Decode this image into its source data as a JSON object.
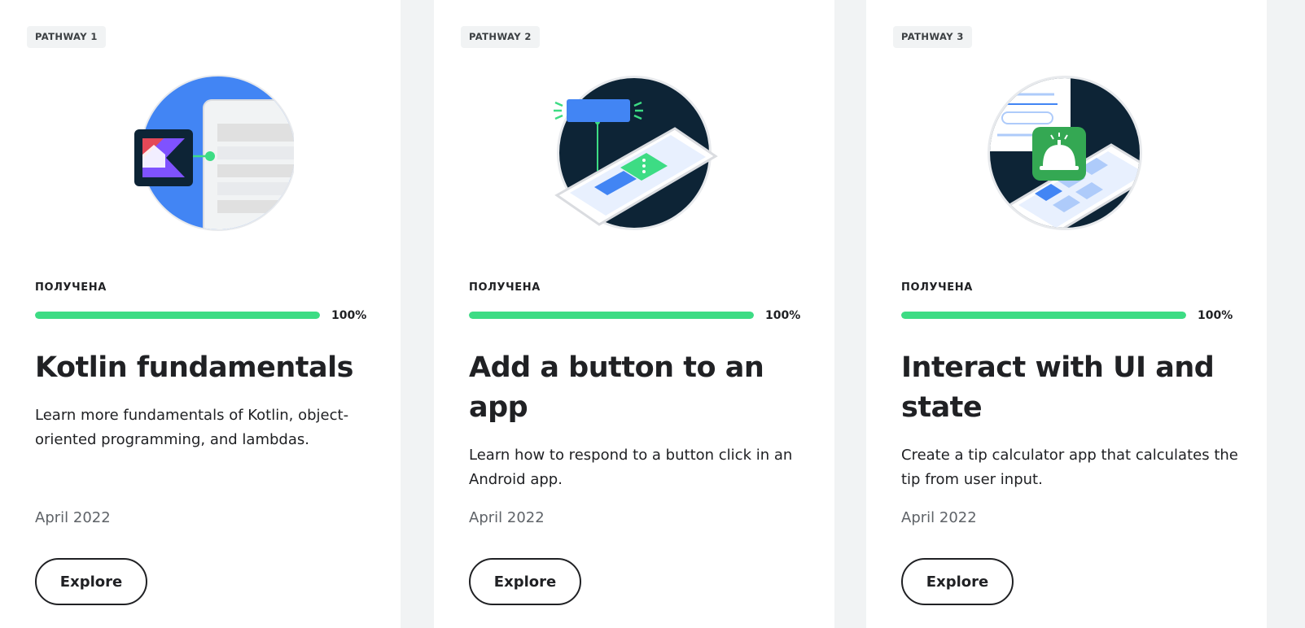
{
  "cards": [
    {
      "pathway": "PATHWAY 1",
      "status": "ПОЛУЧЕНА",
      "progress_percent": 100,
      "progress_label": "100%",
      "title": "Kotlin fundamentals",
      "description": "Learn more fundamentals of Kotlin, object-oriented programming, and lambdas.",
      "date": "April 2022",
      "button_label": "Explore",
      "illustration_icon": "kotlin-logo-icon"
    },
    {
      "pathway": "PATHWAY 2",
      "status": "ПОЛУЧЕНА",
      "progress_percent": 100,
      "progress_label": "100%",
      "title": "Add a button to an app",
      "description": "Learn how to respond to a button click in an Android app.",
      "date": "April 2022",
      "button_label": "Explore",
      "illustration_icon": "phone-button-icon"
    },
    {
      "pathway": "PATHWAY 3",
      "status": "ПОЛУЧЕНА",
      "progress_percent": 100,
      "progress_label": "100%",
      "title": "Interact with UI and state",
      "description": "Create a tip calculator app that calculates the tip from user input.",
      "date": "April 2022",
      "button_label": "Explore",
      "illustration_icon": "service-bell-icon"
    }
  ],
  "colors": {
    "progress_fill": "#3ddc84",
    "progress_track": "#e8eaed",
    "text": "#202124",
    "muted": "#5f6368",
    "page_bg": "#f1f3f4"
  }
}
